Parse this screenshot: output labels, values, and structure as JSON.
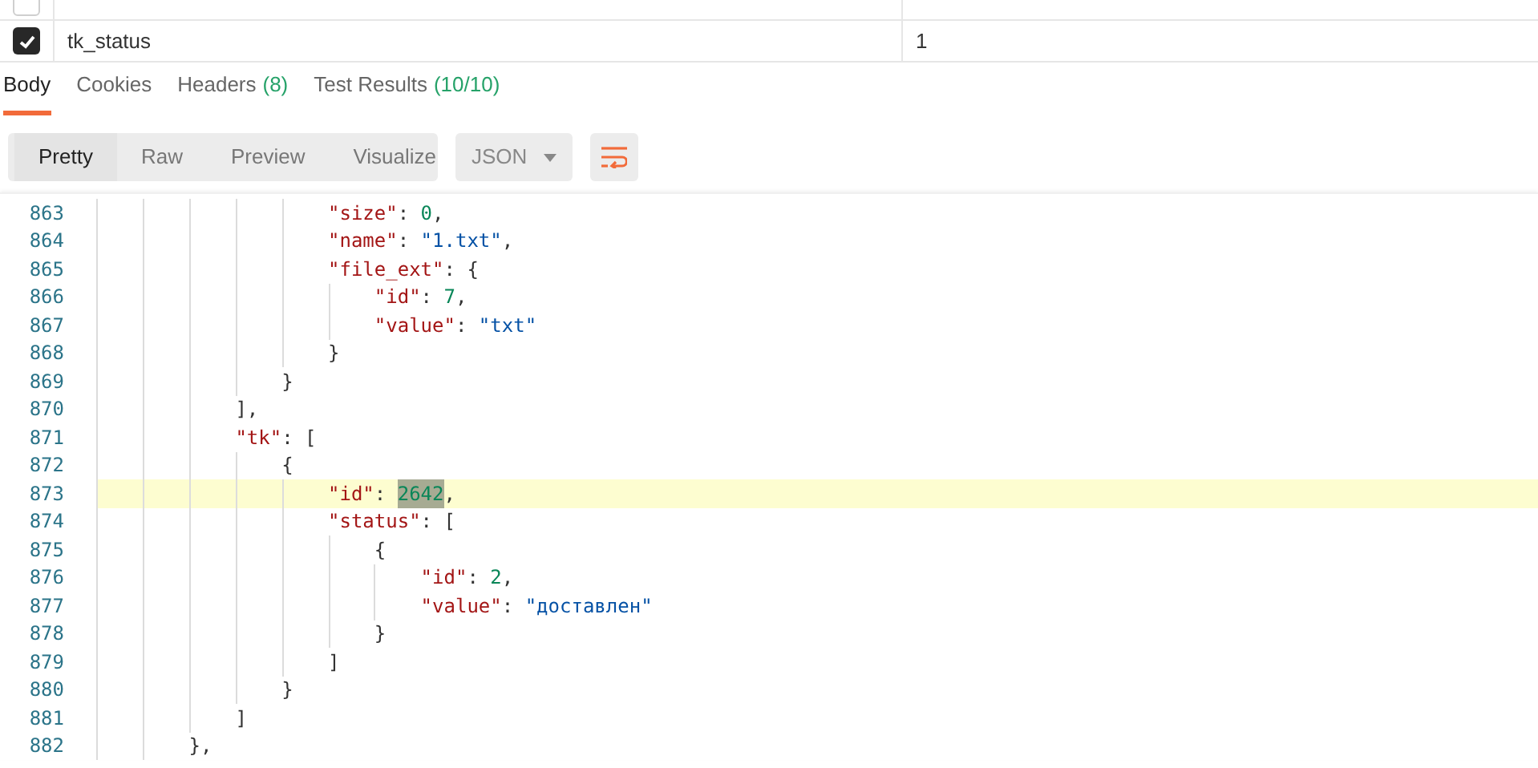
{
  "params_table": {
    "rows": [
      {
        "checked": false
      },
      {
        "checked": true,
        "key": "tk_status",
        "value": "1"
      }
    ]
  },
  "response_tabs": [
    {
      "label": "Body",
      "selected": true
    },
    {
      "label": "Cookies",
      "selected": false
    },
    {
      "label": "Headers",
      "count": "(8)",
      "selected": false
    },
    {
      "label": "Test Results",
      "count": "(10/10)",
      "selected": false
    }
  ],
  "view_modes": [
    {
      "label": "Pretty",
      "selected": true
    },
    {
      "label": "Raw",
      "selected": false
    },
    {
      "label": "Preview",
      "selected": false
    },
    {
      "label": "Visualize",
      "selected": false
    }
  ],
  "format_dropdown": {
    "value": "JSON"
  },
  "wrap_lines": {
    "on": true
  },
  "code": {
    "lines": [
      {
        "number": "863",
        "highlighted": false,
        "tokens": [
          {
            "kind": "key",
            "text": "                    \"size\"",
            "match": false
          },
          {
            "kind": "punct",
            "text": ": ",
            "match": false
          },
          {
            "kind": "number",
            "text": "0",
            "match": false
          },
          {
            "kind": "punct",
            "text": ",",
            "match": false
          }
        ]
      },
      {
        "number": "864",
        "highlighted": false,
        "tokens": [
          {
            "kind": "key",
            "text": "                    \"name\"",
            "match": false
          },
          {
            "kind": "punct",
            "text": ": ",
            "match": false
          },
          {
            "kind": "string",
            "text": "\"1.txt\"",
            "match": false
          },
          {
            "kind": "punct",
            "text": ",",
            "match": false
          }
        ]
      },
      {
        "number": "865",
        "highlighted": false,
        "tokens": [
          {
            "kind": "key",
            "text": "                    \"file_ext\"",
            "match": false
          },
          {
            "kind": "punct",
            "text": ": {",
            "match": false
          }
        ]
      },
      {
        "number": "866",
        "highlighted": false,
        "tokens": [
          {
            "kind": "key",
            "text": "                        \"id\"",
            "match": false
          },
          {
            "kind": "punct",
            "text": ": ",
            "match": false
          },
          {
            "kind": "number",
            "text": "7",
            "match": false
          },
          {
            "kind": "punct",
            "text": ",",
            "match": false
          }
        ]
      },
      {
        "number": "867",
        "highlighted": false,
        "tokens": [
          {
            "kind": "key",
            "text": "                        \"value\"",
            "match": false
          },
          {
            "kind": "punct",
            "text": ": ",
            "match": false
          },
          {
            "kind": "string",
            "text": "\"txt\"",
            "match": false
          }
        ]
      },
      {
        "number": "868",
        "highlighted": false,
        "tokens": [
          {
            "kind": "punct",
            "text": "                    }",
            "match": false
          }
        ]
      },
      {
        "number": "869",
        "highlighted": false,
        "tokens": [
          {
            "kind": "punct",
            "text": "                }",
            "match": false
          }
        ]
      },
      {
        "number": "870",
        "highlighted": false,
        "tokens": [
          {
            "kind": "punct",
            "text": "            ],",
            "match": false
          }
        ]
      },
      {
        "number": "871",
        "highlighted": false,
        "tokens": [
          {
            "kind": "key",
            "text": "            \"tk\"",
            "match": false
          },
          {
            "kind": "punct",
            "text": ": [",
            "match": false
          }
        ]
      },
      {
        "number": "872",
        "highlighted": false,
        "tokens": [
          {
            "kind": "punct",
            "text": "                {",
            "match": false
          }
        ]
      },
      {
        "number": "873",
        "highlighted": true,
        "tokens": [
          {
            "kind": "key",
            "text": "                    \"id\"",
            "match": false
          },
          {
            "kind": "punct",
            "text": ": ",
            "match": false
          },
          {
            "kind": "number",
            "text": "2642",
            "match": true
          },
          {
            "kind": "punct",
            "text": ",",
            "match": false
          }
        ]
      },
      {
        "number": "874",
        "highlighted": false,
        "tokens": [
          {
            "kind": "key",
            "text": "                    \"status\"",
            "match": false
          },
          {
            "kind": "punct",
            "text": ": [",
            "match": false
          }
        ]
      },
      {
        "number": "875",
        "highlighted": false,
        "tokens": [
          {
            "kind": "punct",
            "text": "                        {",
            "match": false
          }
        ]
      },
      {
        "number": "876",
        "highlighted": false,
        "tokens": [
          {
            "kind": "key",
            "text": "                            \"id\"",
            "match": false
          },
          {
            "kind": "punct",
            "text": ": ",
            "match": false
          },
          {
            "kind": "number",
            "text": "2",
            "match": false
          },
          {
            "kind": "punct",
            "text": ",",
            "match": false
          }
        ]
      },
      {
        "number": "877",
        "highlighted": false,
        "tokens": [
          {
            "kind": "key",
            "text": "                            \"value\"",
            "match": false
          },
          {
            "kind": "punct",
            "text": ": ",
            "match": false
          },
          {
            "kind": "string",
            "text": "\"доставлен\"",
            "match": false
          }
        ]
      },
      {
        "number": "878",
        "highlighted": false,
        "tokens": [
          {
            "kind": "punct",
            "text": "                        }",
            "match": false
          }
        ]
      },
      {
        "number": "879",
        "highlighted": false,
        "tokens": [
          {
            "kind": "punct",
            "text": "                    ]",
            "match": false
          }
        ]
      },
      {
        "number": "880",
        "highlighted": false,
        "tokens": [
          {
            "kind": "punct",
            "text": "                }",
            "match": false
          }
        ]
      },
      {
        "number": "881",
        "highlighted": false,
        "tokens": [
          {
            "kind": "punct",
            "text": "            ]",
            "match": false
          }
        ]
      },
      {
        "number": "882",
        "highlighted": false,
        "tokens": [
          {
            "kind": "punct",
            "text": "        },",
            "match": false
          }
        ]
      }
    ]
  }
}
